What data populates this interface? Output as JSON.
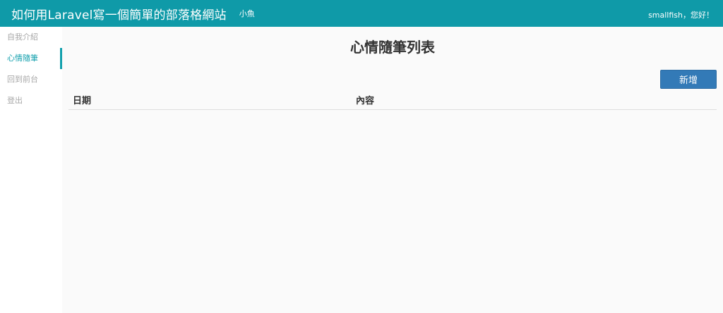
{
  "header": {
    "site_title": "如何用Laravel寫一個簡單的部落格網站",
    "author": "小魚",
    "greeting": "smallfish，您好！"
  },
  "sidebar": {
    "items": [
      {
        "label": "自我介紹",
        "active": false
      },
      {
        "label": "心情隨筆",
        "active": true
      },
      {
        "label": "回到前台",
        "active": false
      },
      {
        "label": "登出",
        "active": false
      }
    ]
  },
  "main": {
    "title": "心情隨筆列表",
    "add_button_label": "新增",
    "table": {
      "columns": [
        "日期",
        "內容"
      ],
      "rows": []
    }
  },
  "colors": {
    "header_bg": "#0f9aa8",
    "accent": "#13a0ad",
    "primary_button": "#337ab7"
  }
}
